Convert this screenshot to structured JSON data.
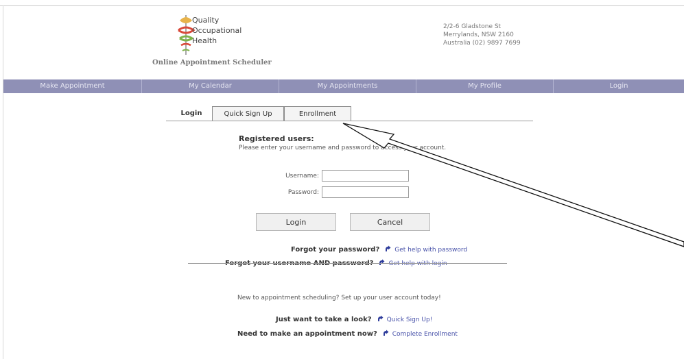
{
  "header": {
    "brand_lines": [
      "Quality",
      "Occupational",
      "Health"
    ],
    "tagline": "Online Appointment Scheduler",
    "address_lines": [
      "2/2-6 Gladstone St",
      "Merrylands, NSW 2160",
      "Australia (02) 9897 7699"
    ]
  },
  "nav": {
    "items": [
      {
        "label": "Make Appointment"
      },
      {
        "label": "My Calendar"
      },
      {
        "label": "My Appointments"
      },
      {
        "label": "My Profile"
      },
      {
        "label": "Login"
      }
    ]
  },
  "tabs": [
    {
      "label": "Login",
      "active": true
    },
    {
      "label": "Quick Sign Up",
      "active": false
    },
    {
      "label": "Enrollment",
      "active": false
    }
  ],
  "login": {
    "title": "Registered users:",
    "instruction": "Please enter your username and password to access your account.",
    "username_label": "Username:",
    "username_value": "",
    "password_label": "Password:",
    "password_value": "",
    "login_button": "Login",
    "cancel_button": "Cancel"
  },
  "help": {
    "forgot_password_q": "Forgot your password?",
    "forgot_password_link": "Get help with password",
    "forgot_both_q": "Forgot your username AND password?",
    "forgot_both_link": "Get help with login"
  },
  "new_users": {
    "text": "New to appointment scheduling? Set up your user account today!",
    "look_q": "Just want to take a look?",
    "look_link": "Quick Sign Up!",
    "appt_q": "Need to make an appointment now?",
    "appt_link": "Complete Enrollment"
  },
  "colors": {
    "nav_background": "#8f90b6",
    "link": "#4650a8",
    "help_arrow_icon": "#2f3d9c"
  }
}
